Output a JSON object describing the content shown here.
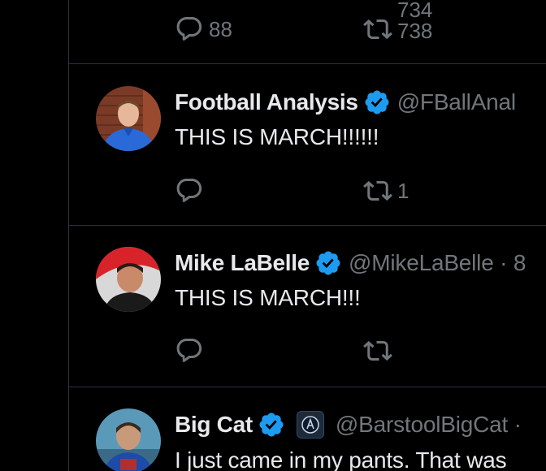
{
  "tweets": [
    {
      "reply_count": "88",
      "retweet_counts": [
        "734",
        "738"
      ]
    },
    {
      "name": "Football Analysis",
      "handle": "@FBallAnal",
      "text": "THIS IS MARCH!!!!!!",
      "reply_count": "",
      "retweet_count": "1"
    },
    {
      "name": "Mike LaBelle",
      "handle": "@MikeLaBelle · 8",
      "text": "THIS IS MARCH!!!",
      "reply_count": "",
      "retweet_count": ""
    },
    {
      "name": "Big Cat",
      "handle": "@BarstoolBigCat · ",
      "text": "I just came in my pants. That was"
    }
  ],
  "colors": {
    "background": "#000000",
    "text": "#e7e9ea",
    "muted": "#71767b",
    "verified": "#1d9bf0",
    "divider": "#2f3336"
  }
}
